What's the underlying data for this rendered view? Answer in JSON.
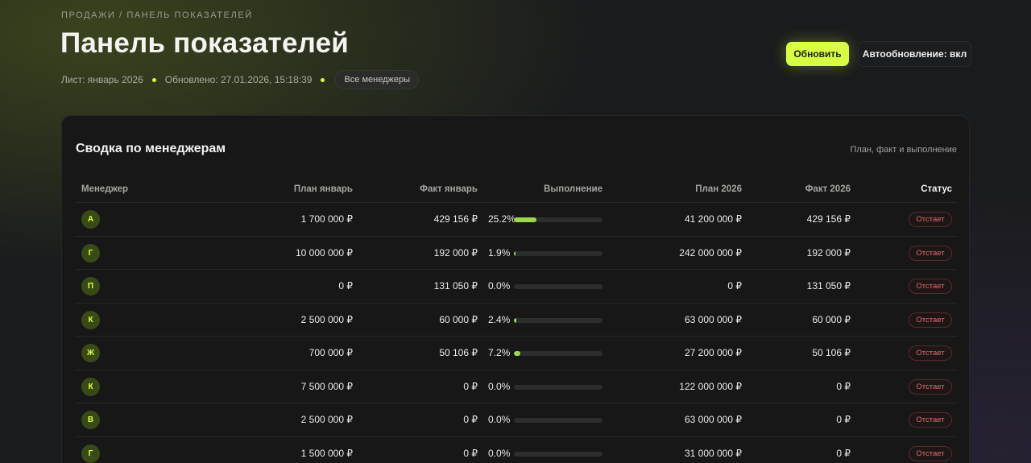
{
  "breadcrumb": "ПРОДАЖИ / ПАНЕЛЬ ПОКАЗАТЕЛЕЙ",
  "title": "Панель показателей",
  "meta": {
    "sheet": "Лист: январь 2026",
    "updated": "Обновлено: 27.01.2026, 15:18:39",
    "filter_chip": "Все менеджеры"
  },
  "actions": {
    "refresh_label": "Обновить",
    "auto_refresh_label": "Автообновление: вкл"
  },
  "colors": {
    "accent": "#d9ff45",
    "progress": "#9bd94a",
    "status_lagging": "#e46b6b"
  },
  "summary": {
    "title": "Сводка по менеджерам",
    "subtitle": "План, факт и выполнение",
    "columns": {
      "manager": "Менеджер",
      "plan_month": "План январь",
      "fact_month": "Факт январь",
      "completion": "Выполнение",
      "plan_year": "План 2026",
      "fact_year": "Факт 2026",
      "status": "Статус"
    },
    "rows": [
      {
        "initial": "А",
        "plan_month": "1 700 000 ₽",
        "fact_month": "429 156 ₽",
        "completion": "25.2%",
        "progress": 0.252,
        "plan_year": "41 200 000 ₽",
        "fact_year": "429 156 ₽",
        "status": "Отстает"
      },
      {
        "initial": "Г",
        "plan_month": "10 000 000 ₽",
        "fact_month": "192 000 ₽",
        "completion": "1.9%",
        "progress": 0.019,
        "plan_year": "242 000 000 ₽",
        "fact_year": "192 000 ₽",
        "status": "Отстает"
      },
      {
        "initial": "П",
        "plan_month": "0 ₽",
        "fact_month": "131 050 ₽",
        "completion": "0.0%",
        "progress": 0.0,
        "plan_year": "0 ₽",
        "fact_year": "131 050 ₽",
        "status": "Отстает"
      },
      {
        "initial": "К",
        "plan_month": "2 500 000 ₽",
        "fact_month": "60 000 ₽",
        "completion": "2.4%",
        "progress": 0.024,
        "plan_year": "63 000 000 ₽",
        "fact_year": "60 000 ₽",
        "status": "Отстает"
      },
      {
        "initial": "Ж",
        "plan_month": "700 000 ₽",
        "fact_month": "50 106 ₽",
        "completion": "7.2%",
        "progress": 0.072,
        "plan_year": "27 200 000 ₽",
        "fact_year": "50 106 ₽",
        "status": "Отстает"
      },
      {
        "initial": "К",
        "plan_month": "7 500 000 ₽",
        "fact_month": "0 ₽",
        "completion": "0.0%",
        "progress": 0.0,
        "plan_year": "122 000 000 ₽",
        "fact_year": "0 ₽",
        "status": "Отстает"
      },
      {
        "initial": "В",
        "plan_month": "2 500 000 ₽",
        "fact_month": "0 ₽",
        "completion": "0.0%",
        "progress": 0.0,
        "plan_year": "63 000 000 ₽",
        "fact_year": "0 ₽",
        "status": "Отстает"
      },
      {
        "initial": "Г",
        "plan_month": "1 500 000 ₽",
        "fact_month": "0 ₽",
        "completion": "0.0%",
        "progress": 0.0,
        "plan_year": "31 000 000 ₽",
        "fact_year": "0 ₽",
        "status": "Отстает"
      }
    ]
  }
}
